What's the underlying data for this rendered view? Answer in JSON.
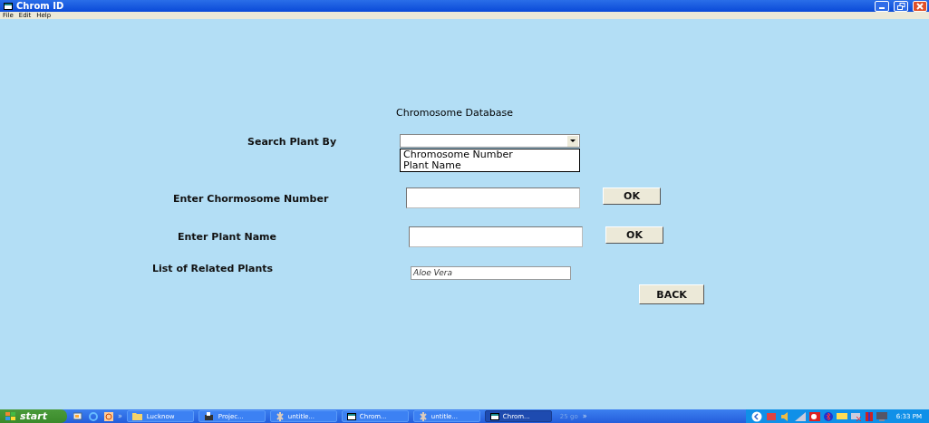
{
  "window": {
    "title": "Chrom ID"
  },
  "menu": [
    "File",
    "Edit",
    "Help"
  ],
  "form": {
    "heading": "Chromosome Database",
    "search_by": {
      "label": "Search Plant By",
      "options": [
        "Chromosome Number",
        "Plant Name"
      ]
    },
    "chromosome": {
      "label": "Enter Chormosome Number",
      "button": "OK"
    },
    "plant_name": {
      "label": "Enter Plant Name",
      "button": "OK"
    },
    "related": {
      "label": "List of Related Plants",
      "items": [
        "Aloe Vera"
      ]
    },
    "back_button": "BACK"
  },
  "taskbar": {
    "start": "start",
    "more": "»",
    "tasks": [
      {
        "label": "Lucknow",
        "kind": "folder",
        "selected": false
      },
      {
        "label": "Projec...",
        "kind": "app",
        "selected": false
      },
      {
        "label": "untitle...",
        "kind": "paint",
        "selected": false
      },
      {
        "label": "Chrom...",
        "kind": "window",
        "selected": false
      },
      {
        "label": "untitle...",
        "kind": "paint",
        "selected": false
      },
      {
        "label": "Chrom...",
        "kind": "window",
        "selected": true
      }
    ],
    "toolbar_text": "25 go",
    "tray_more": "»",
    "clock": "6:33 PM"
  }
}
